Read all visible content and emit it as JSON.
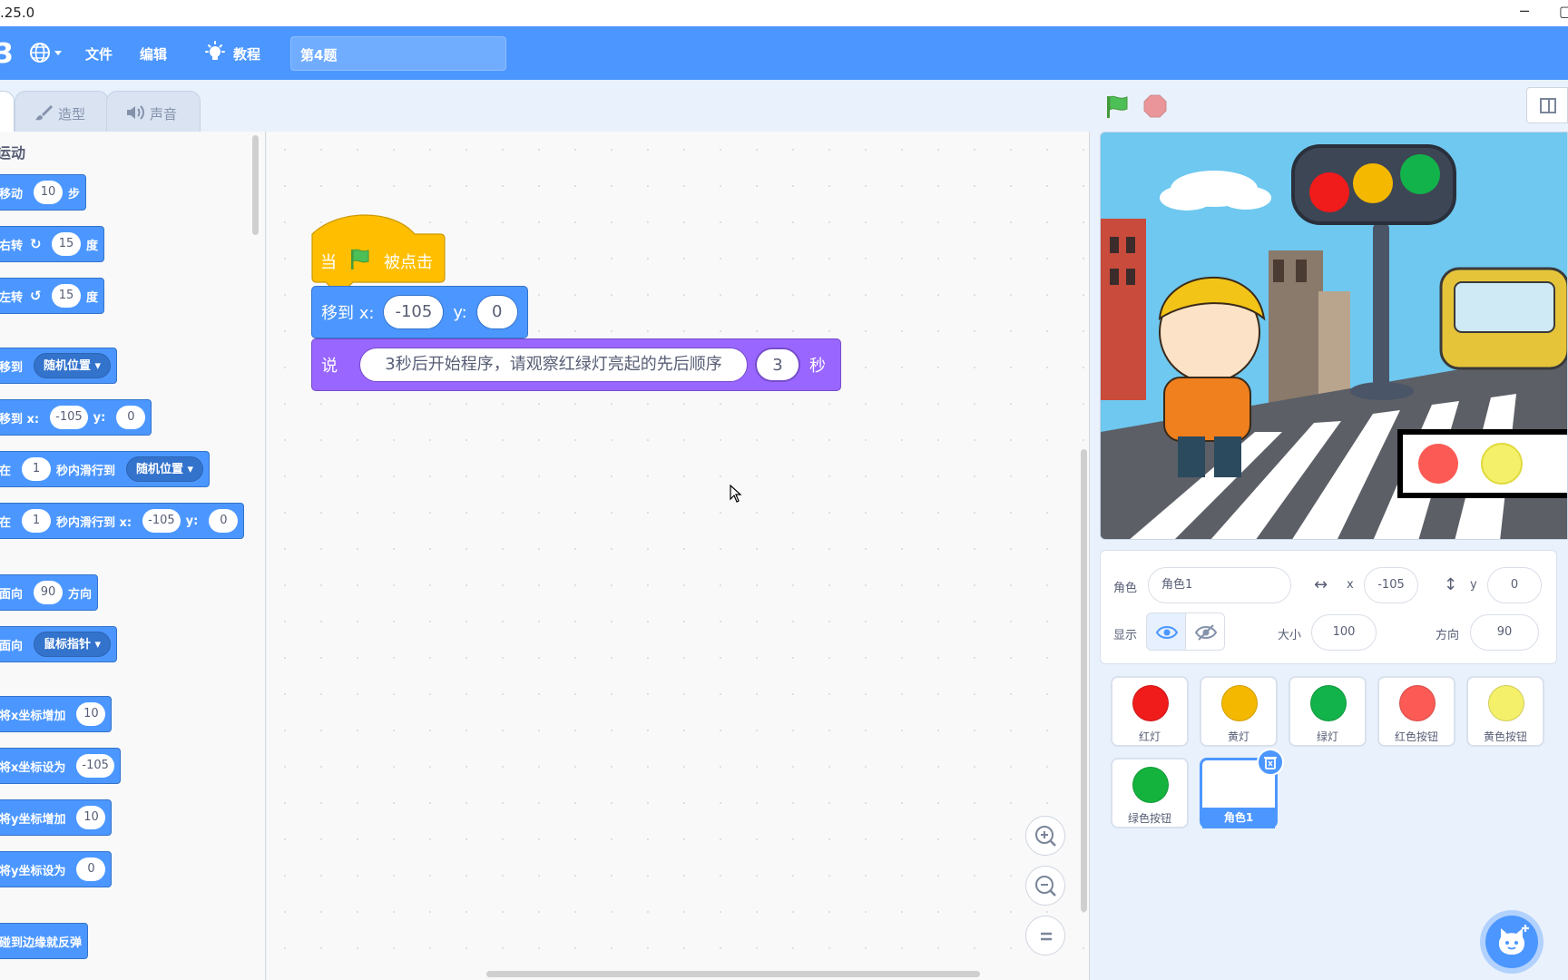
{
  "window": {
    "version": ".25.0",
    "minimize": "─",
    "close_fragment": "⨯"
  },
  "menubar": {
    "file": "文件",
    "edit": "编辑",
    "tutorials": "教程",
    "project_title": "第4题",
    "logo_fragment": "3"
  },
  "tabs": {
    "costumes": "造型",
    "sounds": "声音"
  },
  "palette": {
    "category": "运动",
    "blocks": {
      "move": {
        "label": "移动",
        "value": "10",
        "suffix": "步"
      },
      "turn_right": {
        "label": "右转",
        "value": "15",
        "suffix": "度"
      },
      "turn_left": {
        "label": "左转",
        "value": "15",
        "suffix": "度"
      },
      "goto_menu": {
        "label": "移到",
        "option": "随机位置 ▾"
      },
      "goto_xy": {
        "label": "移到 x:",
        "x": "-105",
        "ylabel": "y:",
        "y": "0"
      },
      "glide_menu": {
        "label": "在",
        "secs": "1",
        "mid": "秒内滑行到",
        "option": "随机位置 ▾"
      },
      "glide_xy": {
        "label": "在",
        "secs": "1",
        "mid": "秒内滑行到 x:",
        "x": "-105",
        "ylabel": "y:",
        "y": "0"
      },
      "point_dir": {
        "label": "面向",
        "value": "90",
        "suffix": "方向"
      },
      "point_towards": {
        "label": "面向",
        "option": "鼠标指针 ▾"
      },
      "change_x": {
        "label": "将x坐标增加",
        "value": "10"
      },
      "set_x": {
        "label": "将x坐标设为",
        "value": "-105"
      },
      "change_y": {
        "label": "将y坐标增加",
        "value": "10"
      },
      "set_y": {
        "label": "将y坐标设为",
        "value": "0"
      },
      "bounce": {
        "label": "碰到边缘就反弹"
      }
    }
  },
  "script": {
    "hat": {
      "when": "当",
      "clicked": "被点击"
    },
    "goto": {
      "label": "移到 x:",
      "x": "-105",
      "ylabel": "y:",
      "y": "0"
    },
    "say": {
      "label": "说",
      "message": "3秒后开始程序，请观察红绿灯亮起的先后顺序",
      "secs": "3",
      "unit": "秒"
    }
  },
  "sprite_info": {
    "sprite_label": "角色",
    "sprite_name": "角色1",
    "x_label": "x",
    "x": "-105",
    "y_label": "y",
    "y": "0",
    "show_label": "显示",
    "size_label": "大小",
    "size": "100",
    "direction_label": "方向",
    "direction": "90"
  },
  "sprites": [
    {
      "name": "红灯",
      "color": "#f01b1b"
    },
    {
      "name": "黄灯",
      "color": "#f5b800"
    },
    {
      "name": "绿灯",
      "color": "#12b34a"
    },
    {
      "name": "红色按钮",
      "color": "#fb5a55"
    },
    {
      "name": "黄色按钮",
      "color": "#f4f06a"
    },
    {
      "name": "绿色按钮",
      "color": "#14b33e"
    },
    {
      "name": "角色1",
      "color": "#ffffff",
      "selected": true
    }
  ],
  "colors": {
    "menubar": "#4c97ff",
    "motion": "#4c97ff",
    "looks": "#9966ff",
    "events": "#ffbf00"
  }
}
